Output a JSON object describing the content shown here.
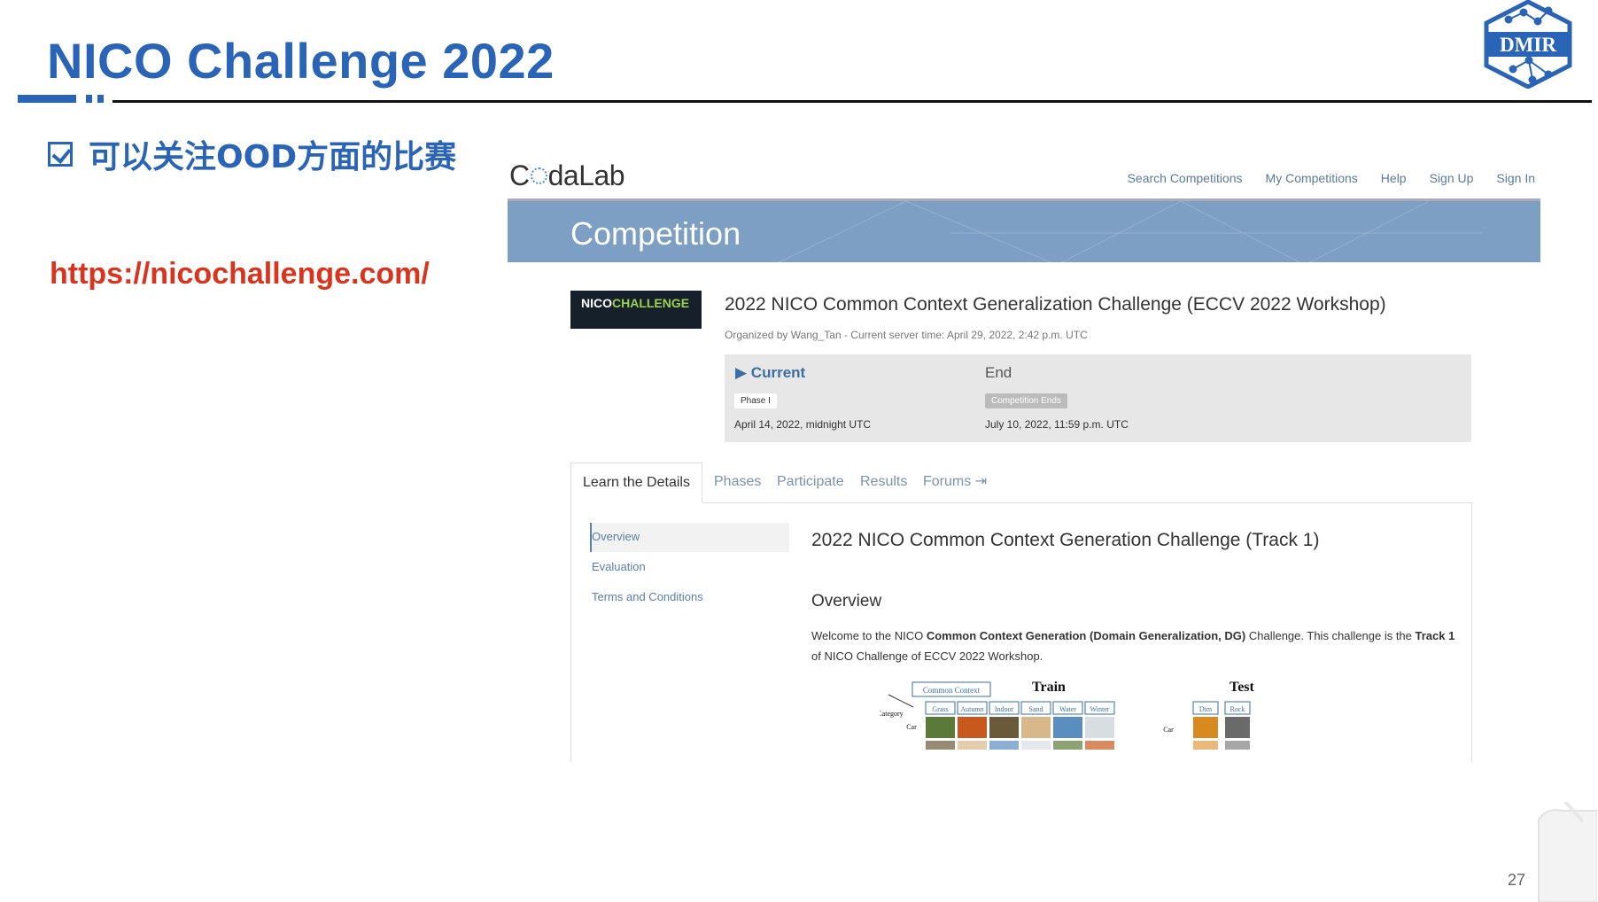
{
  "slide": {
    "title": "NICO Challenge 2022",
    "bullet": "可以关注OOD方面的比赛",
    "url": "https://nicochallenge.com/",
    "logo_text": "DMIR",
    "page_number": "27"
  },
  "codalab": {
    "brand_left": "C",
    "brand_right": "daLab",
    "nav": [
      "Search Competitions",
      "My Competitions",
      "Help",
      "Sign Up",
      "Sign In"
    ],
    "banner": "Competition",
    "competition_logo": {
      "part1": "NICO",
      "part2": "CHALLENGE"
    },
    "competition_title": "2022 NICO Common Context Generalization Challenge (ECCV 2022 Workshop)",
    "organized_by": "Organized by Wang_Tan - Current server time: April 29, 2022, 2:42 p.m. UTC",
    "phases": {
      "current_label": "Current",
      "current_badge": "Phase I",
      "current_date": "April 14, 2022, midnight UTC",
      "end_label": "End",
      "end_badge": "Competition Ends",
      "end_date": "July 10, 2022, 11:59 p.m. UTC"
    },
    "tabs": [
      "Learn the Details",
      "Phases",
      "Participate",
      "Results",
      "Forums"
    ],
    "side_nav": [
      "Overview",
      "Evaluation",
      "Terms and Conditions"
    ],
    "track_title": "2022 NICO Common Context Generation Challenge (Track 1)",
    "overview_heading": "Overview",
    "overview_text": {
      "p1": "Welcome to the NICO ",
      "b1": "Common Context Generation (Domain Generalization, DG)",
      "p2": " Challenge. This challenge is the ",
      "b2": "Track 1",
      "p3": " of NICO Challenge of ECCV 2022 Workshop."
    },
    "figure": {
      "train_label": "Train",
      "test_label": "Test",
      "common_context": "Common Context",
      "category_label": "Category",
      "row_label": "Car",
      "train_contexts": [
        "Grass",
        "Autumn",
        "Indoor",
        "Sand",
        "Water",
        "Winter"
      ],
      "test_contexts": [
        "Dim",
        "Rock"
      ]
    }
  },
  "colors": {
    "accent_blue": "#2a64b6",
    "url_red": "#d9341e",
    "banner": "#7d9fc4"
  }
}
